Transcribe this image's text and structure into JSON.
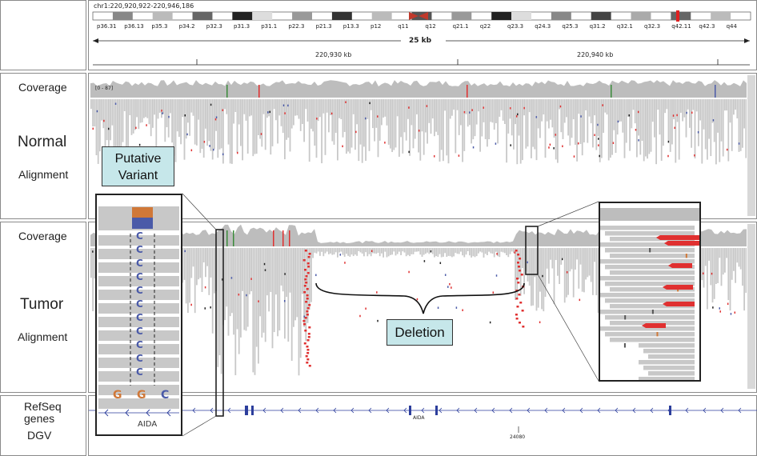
{
  "locus": "chr1:220,920,922-220,946,186",
  "bands": [
    "p36.31",
    "p36.13",
    "p35.3",
    "p34.2",
    "p32.3",
    "p31.3",
    "p31.1",
    "p22.3",
    "p21.3",
    "p13.3",
    "p12",
    "q11",
    "q12",
    "q21.1",
    "q22",
    "q23.3",
    "q24.3",
    "q25.3",
    "q31.2",
    "q32.1",
    "q32.3",
    "q42.11",
    "q42.3",
    "q44"
  ],
  "ruler": {
    "span": "25 kb",
    "ticks": [
      "220,930 kb",
      "220,940 kb"
    ]
  },
  "normal": {
    "coverage_label": "Coverage",
    "range": "[0 - 87]",
    "title": "Normal",
    "subtitle": "Alignment"
  },
  "tumor": {
    "coverage_label": "Coverage",
    "title": "Tumor",
    "subtitle": "Alignment"
  },
  "callouts": {
    "variant_line1": "Putative",
    "variant_line2": "Variant",
    "deletion": "Deletion"
  },
  "zoom": {
    "base": "C",
    "ref_bases": [
      "G",
      "G",
      "C"
    ],
    "gene": "AIDA"
  },
  "tracks": {
    "refseq_line1": "RefSeq",
    "refseq_line2": "genes",
    "dgv": "DGV",
    "gene_name": "AIDA",
    "dgv_id": "24080"
  },
  "colors": {
    "read": "#c8c8c8",
    "coverage": "#bdbdbd",
    "mismatch": "#e03030",
    "variant_orange": "#d07838",
    "variant_blue": "#4a5aa8",
    "gene": "#2c3e9c",
    "callout": "#c6e7ea"
  }
}
